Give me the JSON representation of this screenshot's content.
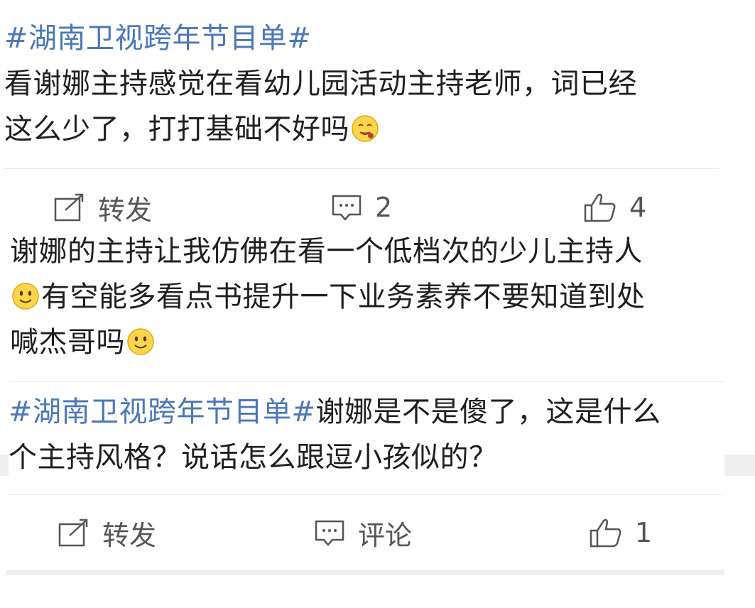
{
  "posts": [
    {
      "tag": "#湖南卫视跨年节目单#",
      "text_line1": "看谢娜主持感觉在看幼儿园活动主持老师，词已经",
      "text_line2": "这么少了，打打基础不好吗",
      "emoji_after": "drooling-emoji",
      "actions": {
        "repost_label": "转发",
        "comment_label": "2",
        "like_label": "4"
      }
    },
    {
      "text_line1": "谢娜的主持让我仿佛在看一个低档次的少儿主持人",
      "text_line2": "有空能多看点书提升一下业务素养不要知道到处",
      "text_line3": "喊杰哥吗",
      "emoji": "smile-emoji"
    },
    {
      "tag": "#湖南卫视跨年节目单#",
      "text_line1_rest": "谢娜是不是傻了，这是什么",
      "text_line2": "个主持风格？说话怎么跟逗小孩似的？",
      "actions": {
        "repost_label": "转发",
        "comment_label": "评论",
        "like_label": "1"
      }
    }
  ],
  "colors": {
    "tag": "#4a78b8",
    "text": "#1f1f1f",
    "action": "#555555",
    "divider": "#e8e8e8"
  }
}
